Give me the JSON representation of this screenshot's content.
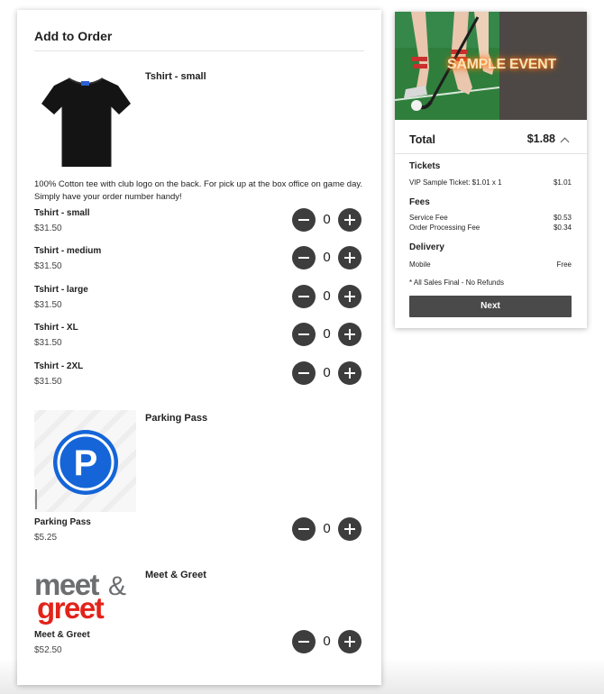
{
  "order": {
    "title": "Add to Order",
    "tshirt": {
      "name": "Tshirt - small",
      "description": "100% Cotton tee with club logo on the back. For pick up at the box office on game day. Simply have your order number handy!",
      "variants": [
        {
          "name": "Tshirt - small",
          "price": "$31.50",
          "qty": "0"
        },
        {
          "name": "Tshirt - medium",
          "price": "$31.50",
          "qty": "0"
        },
        {
          "name": "Tshirt - large",
          "price": "$31.50",
          "qty": "0"
        },
        {
          "name": "Tshirt - XL",
          "price": "$31.50",
          "qty": "0"
        },
        {
          "name": "Tshirt - 2XL",
          "price": "$31.50",
          "qty": "0"
        }
      ]
    },
    "parking": {
      "name": "Parking Pass",
      "logo_letter": "P",
      "variant": {
        "name": "Parking Pass",
        "price": "$5.25",
        "qty": "0"
      }
    },
    "meet": {
      "name": "Meet & Greet",
      "logo_line1": "meet",
      "logo_amp": "&",
      "logo_line2": "greet",
      "variant": {
        "name": "Meet & Greet",
        "price": "$52.50",
        "qty": "0"
      }
    },
    "icons": {
      "minus": "minus-circle-icon",
      "plus": "plus-circle-icon"
    }
  },
  "summary": {
    "event_title": "SAMPLE EVENT",
    "total_label": "Total",
    "total_amount": "$1.88",
    "tickets_heading": "Tickets",
    "ticket_line": "VIP Sample Ticket: $1.01 x 1",
    "ticket_value": "$1.01",
    "fees_heading": "Fees",
    "service_fee_label": "Service Fee",
    "service_fee_value": "$0.53",
    "processing_fee_label": "Order Processing Fee",
    "processing_fee_value": "$0.34",
    "delivery_heading": "Delivery",
    "delivery_method": "Mobile",
    "delivery_value": "Free",
    "note": "* All Sales Final - No Refunds",
    "next_label": "Next"
  },
  "colors": {
    "stepper": "#3d3d3d",
    "parking_blue": "#1565d8",
    "meet_gray": "#6d6e70",
    "greet_red": "#e2231a",
    "button": "#4a4a4a",
    "turf": "#2e7d3a"
  }
}
